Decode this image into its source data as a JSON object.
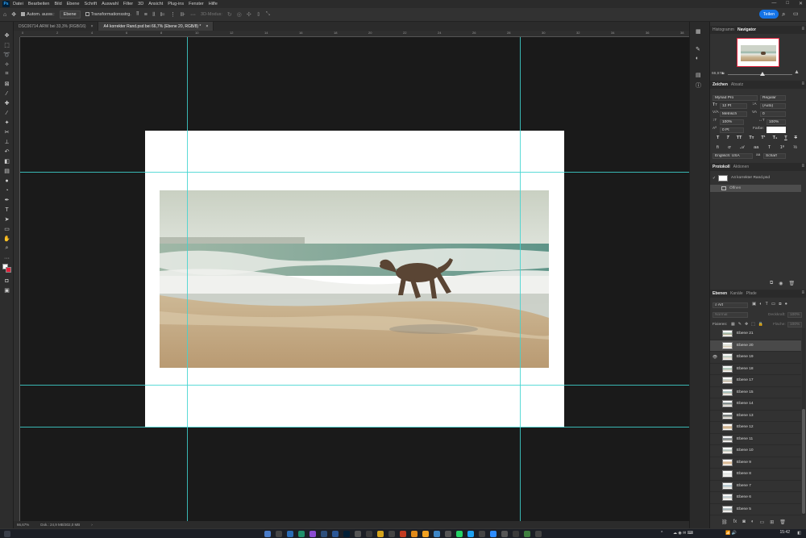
{
  "menubar": {
    "app_icon": "Ps",
    "items": [
      "Datei",
      "Bearbeiten",
      "Bild",
      "Ebene",
      "Schrift",
      "Auswahl",
      "Filter",
      "3D",
      "Ansicht",
      "Plug-ins",
      "Fenster",
      "Hilfe"
    ],
    "window_controls": [
      "—",
      "□",
      "✕"
    ]
  },
  "options_bar": {
    "auto_select_label": "Autom. ausw.:",
    "auto_select_value": "Ebene",
    "transform_label": "Transformationsstrg.",
    "mode_3d": "3D-Modus:",
    "share_label": "Teilen"
  },
  "tabs": [
    {
      "label": "DSC06714.ARW bei 33,3% (RGB/16)",
      "close": "×"
    },
    {
      "label": "A4 korrekter Rand.psd bei 66,7% (Ebene 20, RGB/8) *",
      "close": "×"
    }
  ],
  "ruler_top": [
    "0",
    "2",
    "4",
    "6",
    "8",
    "10",
    "12",
    "14",
    "16",
    "18",
    "20",
    "22",
    "24",
    "26",
    "28",
    "30",
    "32",
    "34",
    "36",
    "38"
  ],
  "status": {
    "zoom": "66,67%",
    "doc_info": "Dok.: 24,9 MB/302,0 MB"
  },
  "navigator": {
    "tabs": [
      "Histogramm",
      "Navigator"
    ],
    "zoom": "66,67%"
  },
  "character": {
    "tabs": [
      "Zeichen",
      "Absatz"
    ],
    "font_family": "Myriad Pro",
    "font_style": "Regular",
    "font_size": "12 Pt",
    "leading": "(Auto)",
    "kerning": "Metrisch",
    "tracking": "0",
    "vscale": "100%",
    "hscale": "100%",
    "baseline": "0 Pt",
    "color_label": "Farbe:",
    "language": "Englisch: USA",
    "aa_label": "aa",
    "antialias": "Scharf",
    "type_buttons": [
      "T",
      "T",
      "TT",
      "Tт",
      "T¹",
      "T₁",
      "T",
      "T"
    ]
  },
  "history": {
    "tabs": [
      "Protokoll",
      "Aktionen"
    ],
    "snapshot": "A4 korrekter Rand.psd",
    "steps": [
      "Öffnen"
    ]
  },
  "layers": {
    "tabs": [
      "Ebenen",
      "Kanäle",
      "Pfade"
    ],
    "filter_label": "Art",
    "blend_mode": "Normal",
    "opacity_label": "Deckkraft:",
    "opacity": "100%",
    "lock_label": "Fixieren:",
    "fill_label": "Fläche:",
    "fill": "100%",
    "items": [
      {
        "name": "Ebene 21",
        "visible": false,
        "active": false
      },
      {
        "name": "Ebene 20",
        "visible": false,
        "active": true
      },
      {
        "name": "Ebene 19",
        "visible": true,
        "active": false
      },
      {
        "name": "Ebene 18",
        "visible": false,
        "active": false
      },
      {
        "name": "Ebene 17",
        "visible": false,
        "active": false
      },
      {
        "name": "Ebene 15",
        "visible": false,
        "active": false
      },
      {
        "name": "Ebene 14",
        "visible": false,
        "active": false
      },
      {
        "name": "Ebene 13",
        "visible": false,
        "active": false
      },
      {
        "name": "Ebene 12",
        "visible": false,
        "active": false
      },
      {
        "name": "Ebene 11",
        "visible": false,
        "active": false
      },
      {
        "name": "Ebene 10",
        "visible": false,
        "active": false
      },
      {
        "name": "Ebene 9",
        "visible": false,
        "active": false
      },
      {
        "name": "Ebene 8",
        "visible": false,
        "active": false
      },
      {
        "name": "Ebene 7",
        "visible": false,
        "active": false
      },
      {
        "name": "Ebene 6",
        "visible": false,
        "active": false
      },
      {
        "name": "Ebene 5",
        "visible": false,
        "active": false
      }
    ]
  },
  "taskbar": {
    "time": "15:42",
    "date": "22.04.2024"
  },
  "colors": {
    "guide": "#3fd3d0",
    "accent": "#1473e6",
    "foreground": "#ffffff",
    "background": "#e0203a"
  }
}
